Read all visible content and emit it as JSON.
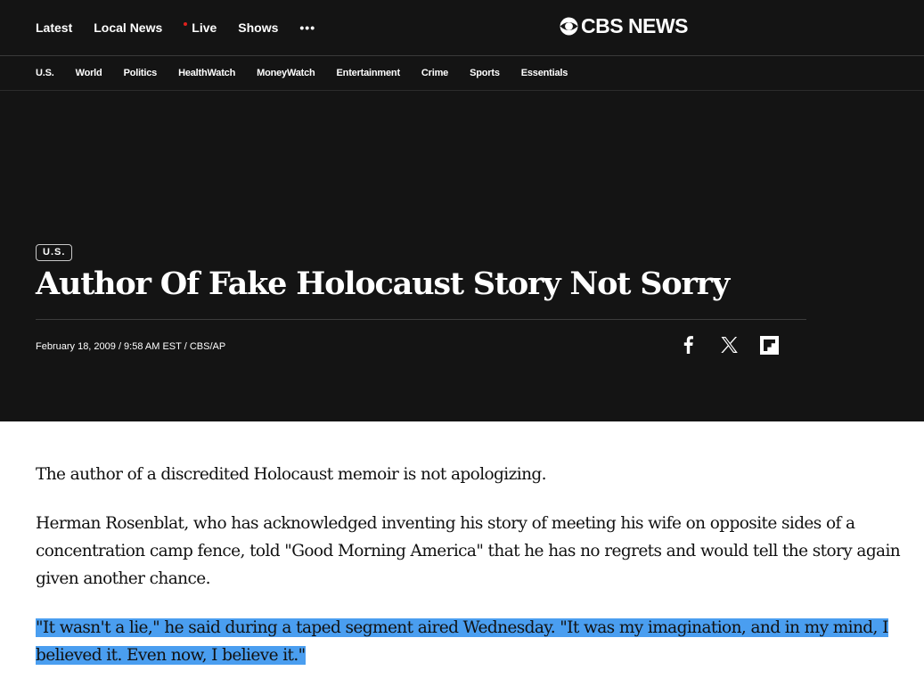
{
  "nav": {
    "primary": [
      "Latest",
      "Local News",
      "Live",
      "Shows"
    ],
    "more": "•••",
    "logo": "CBS NEWS",
    "secondary": [
      "U.S.",
      "World",
      "Politics",
      "HealthWatch",
      "MoneyWatch",
      "Entertainment",
      "Crime",
      "Sports",
      "Essentials"
    ]
  },
  "article": {
    "category": "U.S.",
    "headline": "Author Of Fake Holocaust Story Not Sorry",
    "byline": "February 18, 2009 / 9:58 AM EST / CBS/AP",
    "share": [
      "facebook-icon",
      "x-icon",
      "flipboard-icon"
    ],
    "paragraphs": [
      "The author of a discredited Holocaust memoir is not apologizing.",
      "Herman Rosenblat, who has acknowledged inventing his story of meeting his wife on opposite sides of a concentration camp fence, told \"Good Morning America\" that he has no regrets and would tell the story again given another chance.",
      "\"It wasn't a lie,\" he said during a taped segment aired Wednesday. \"It was my imagination, and in my mind, I believed it. Even now, I believe it.\""
    ]
  },
  "colors": {
    "header_bg": "#141414",
    "live_dot": "#e0201c",
    "selection": "#4a9ef0"
  }
}
